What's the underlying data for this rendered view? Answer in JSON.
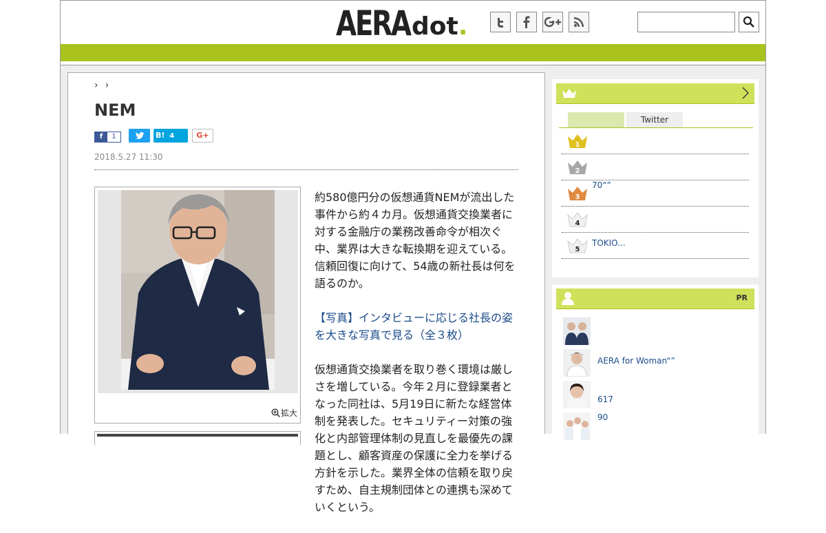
{
  "header": {
    "logo_main": "AERA",
    "logo_sub": "dot",
    "logo_period": ".",
    "social": [
      "twitter-icon",
      "facebook-icon",
      "google-plus-icon",
      "rss-icon"
    ],
    "search_placeholder": ""
  },
  "colors": {
    "accent": "#a9c21e",
    "accent_light": "#cfe15a",
    "link": "#1b4b8a"
  },
  "article": {
    "breadcrumb_sep": [
      "›",
      "›"
    ],
    "title": "NEM",
    "share": {
      "facebook_count": "1",
      "twitter_label": "",
      "hatena_label": "B!",
      "hatena_count": "4",
      "gplus_label": "G+"
    },
    "date": "2018.5.27 11:30",
    "zoom_label": "拡大",
    "paragraphs": [
      "約580億円分の仮想通貨NEMが流出した事件から約４カ月。仮想通貨交換業者に対する金融庁の業務改善命令が相次ぐ中、業界は大きな転換期を迎えている。信頼回復に向けて、54歳の新社長は何を語るのか。",
      "【写真】インタビューに応じる社長の姿を大きな写真で見る（全３枚）",
      "仮想通貨交換業者を取り巻く環境は厳しさを増している。今年２月に登録業者となった同社は、5月19日に新たな経営体制を発表した。セキュリティー対策の強化と内部管理体制の見直しを最優先の課題とし、顧客資産の保護に全力を挙げる方針を示した。業界全体の信頼を取り戻すため、自主規制団体との連携も深めていくという。"
    ]
  },
  "sidebar": {
    "ranking": {
      "tabs": [
        "",
        "Twitter"
      ],
      "items": [
        {
          "rank": "1",
          "text": ""
        },
        {
          "rank": "2",
          "text": ""
        },
        {
          "rank": "3",
          "text": "70“”"
        },
        {
          "rank": "4",
          "text": ""
        },
        {
          "rank": "5",
          "text": "TOKIO..."
        }
      ]
    },
    "pr": {
      "label": "PR",
      "items": [
        {
          "text": ""
        },
        {
          "text": "AERA for Woman“”"
        },
        {
          "text": "617"
        },
        {
          "text": "90"
        }
      ]
    }
  }
}
